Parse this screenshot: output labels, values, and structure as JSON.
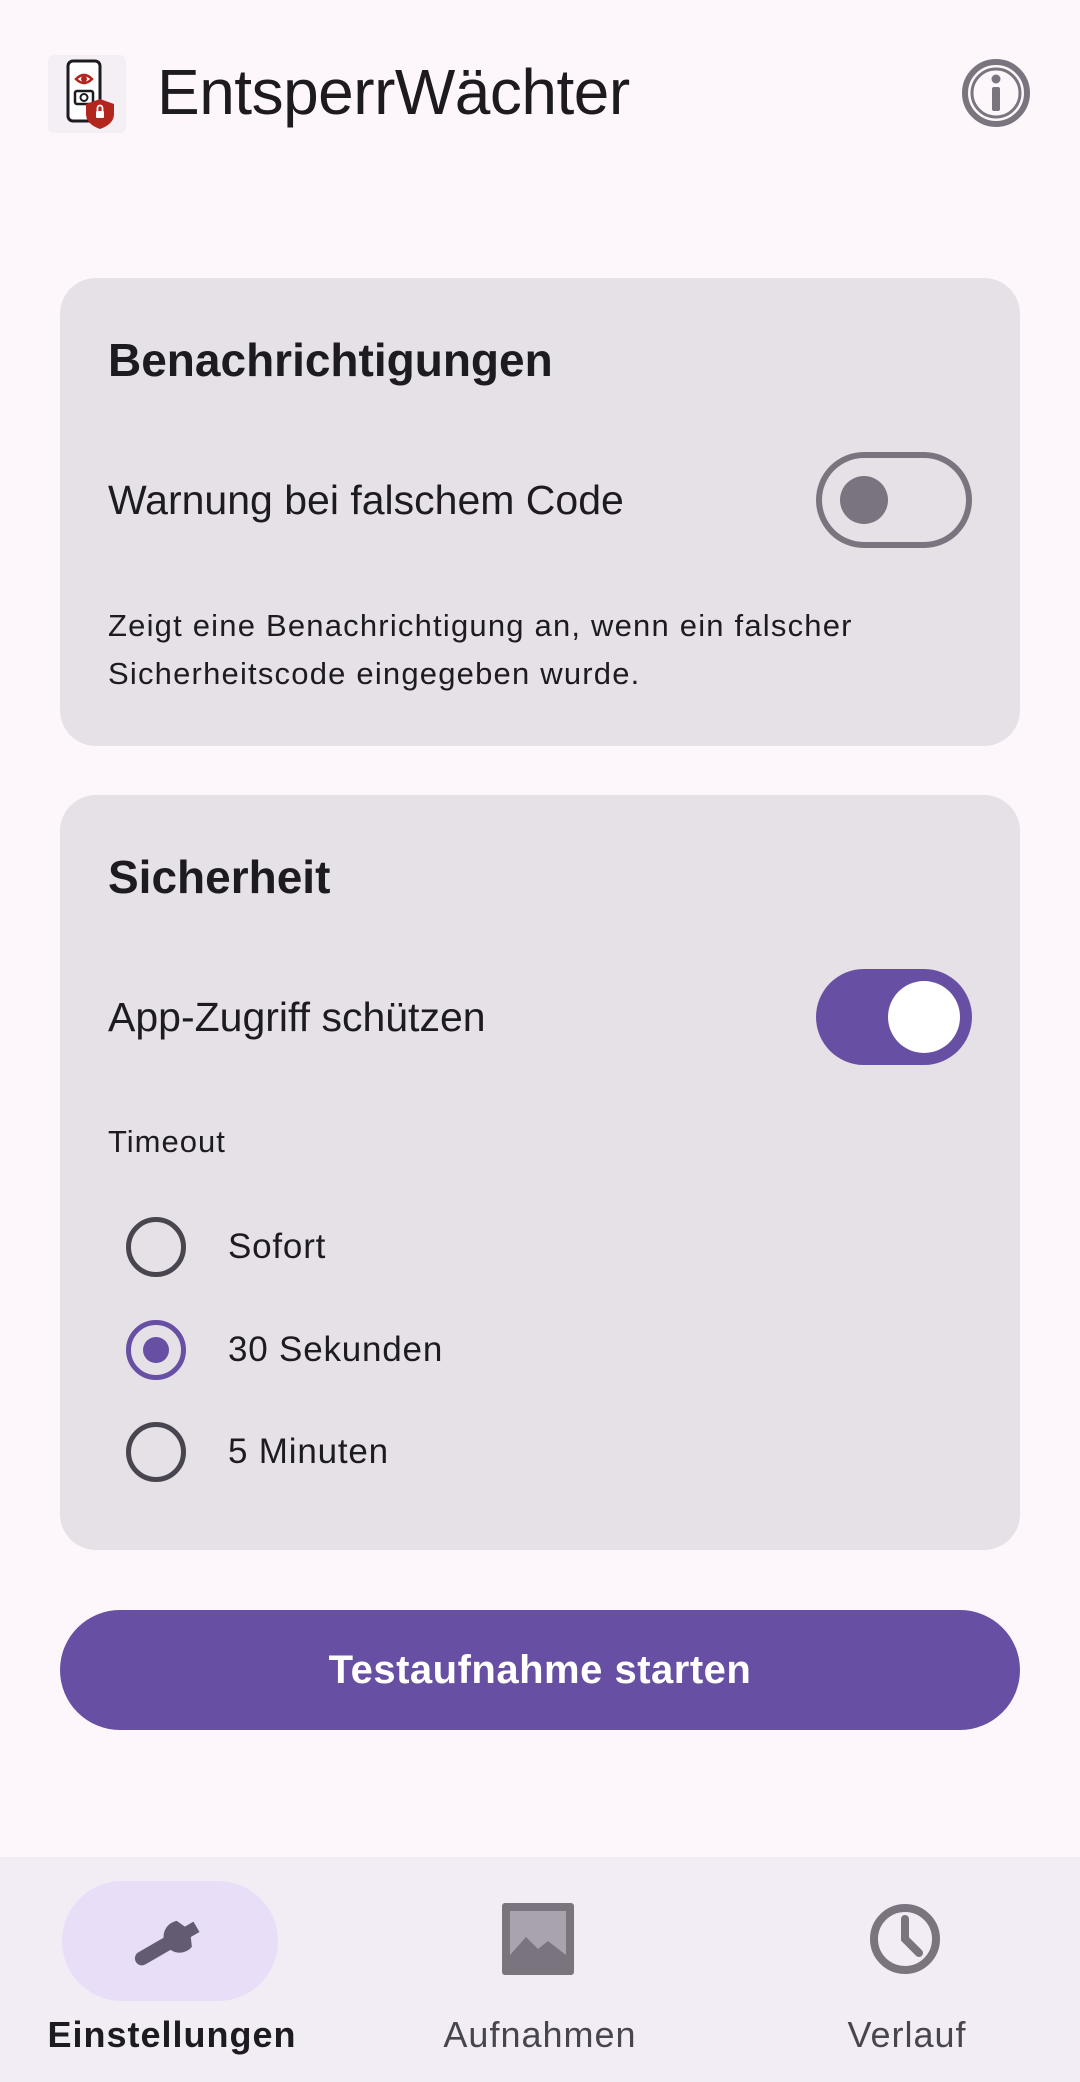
{
  "app": {
    "title": "EntsperrWächter",
    "icons": {
      "logo": "app-logo-icon",
      "info": "info-icon"
    }
  },
  "notifications_card": {
    "title": "Benachrichtigungen",
    "toggle_label": "Warnung bei falschem Code",
    "toggle_on": false,
    "description": "Zeigt eine Benachrichtigung an, wenn ein falscher Sicherheitscode eingegeben wurde."
  },
  "security_card": {
    "title": "Sicherheit",
    "toggle_label": "App-Zugriff schützen",
    "toggle_on": true,
    "timeout_label": "Timeout",
    "options": [
      {
        "label": "Sofort",
        "selected": false
      },
      {
        "label": "30 Sekunden",
        "selected": true
      },
      {
        "label": "5 Minuten",
        "selected": false
      }
    ]
  },
  "primary_button": {
    "label": "Testaufnahme starten"
  },
  "bottom_nav": {
    "items": [
      {
        "label": "Einstellungen",
        "icon": "wrench-icon",
        "active": true
      },
      {
        "label": "Aufnahmen",
        "icon": "image-icon",
        "active": false
      },
      {
        "label": "Verlauf",
        "icon": "clock-icon",
        "active": false
      }
    ]
  },
  "colors": {
    "primary": "#6750A4",
    "background": "#FDF7FC",
    "card": "#E6E0E7",
    "nav_active_pill": "#E8DEF8"
  }
}
